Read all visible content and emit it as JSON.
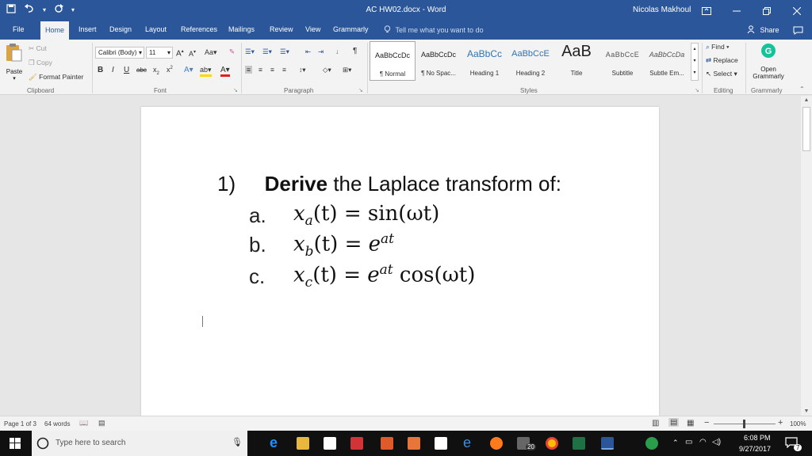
{
  "window": {
    "title": "AC HW02.docx  -  Word",
    "user": "Nicolas Makhoul",
    "quick_access": [
      "save-icon",
      "undo-icon",
      "redo-icon",
      "customize-icon"
    ]
  },
  "tabs": [
    {
      "label": "File"
    },
    {
      "label": "Home",
      "active": true
    },
    {
      "label": "Insert"
    },
    {
      "label": "Design"
    },
    {
      "label": "Layout"
    },
    {
      "label": "References"
    },
    {
      "label": "Mailings"
    },
    {
      "label": "Review"
    },
    {
      "label": "View"
    },
    {
      "label": "Grammarly"
    }
  ],
  "tell_me": "Tell me what you want to do",
  "share": "Share",
  "ribbon": {
    "clipboard": {
      "paste": "Paste",
      "cut": "Cut",
      "copy": "Copy",
      "format_painter": "Format Painter",
      "label": "Clipboard"
    },
    "font": {
      "name": "Calibri (Body)",
      "size": "11",
      "label": "Font"
    },
    "paragraph": {
      "label": "Paragraph"
    },
    "styles": {
      "label": "Styles",
      "items": [
        {
          "sample": "AaBbCcDc",
          "name": "¶ Normal",
          "selected": true
        },
        {
          "sample": "AaBbCcDc",
          "name": "¶ No Spac..."
        },
        {
          "sample": "AaBbCc",
          "name": "Heading 1"
        },
        {
          "sample": "AaBbCcE",
          "name": "Heading 2"
        },
        {
          "sample": "AaB",
          "name": "Title"
        },
        {
          "sample": "AaBbCcE",
          "name": "Subtitle"
        },
        {
          "sample": "AaBbCcDa",
          "name": "Subtle Em..."
        }
      ]
    },
    "editing": {
      "find": "Find",
      "replace": "Replace",
      "select": "Select",
      "label": "Editing"
    },
    "grammarly": {
      "open": "Open",
      "open2": "Grammarly",
      "label": "Grammarly"
    }
  },
  "document": {
    "question_number": "1)",
    "question_bold": "Derive",
    "question_rest": " the Laplace transform of:",
    "items": [
      {
        "label": "a.",
        "lhs_var": "x",
        "lhs_sub": "a",
        "lhs_arg": "(t)",
        "eq": " = ",
        "rhs": "sin(ωt)"
      },
      {
        "label": "b.",
        "lhs_var": "x",
        "lhs_sub": "b",
        "lhs_arg": "(t)",
        "eq": " = ",
        "rhs_base": "e",
        "rhs_sup": "at"
      },
      {
        "label": "c.",
        "lhs_var": "x",
        "lhs_sub": "c",
        "lhs_arg": "(t)",
        "eq": " = ",
        "rhs_base": "e",
        "rhs_sup": "at",
        "rhs_tail": " cos(ωt)"
      }
    ]
  },
  "status": {
    "page": "Page 1 of 3",
    "words": "64 words",
    "zoom": "100%"
  },
  "taskbar": {
    "search_placeholder": "Type here to search",
    "time": "6:08 PM",
    "date": "9/27/2017",
    "badge": "20",
    "notifications": "7"
  },
  "colors": {
    "word_blue": "#2b579a",
    "ribbon_bg": "#f3f3f3",
    "canvas_bg": "#e6e6e6"
  }
}
